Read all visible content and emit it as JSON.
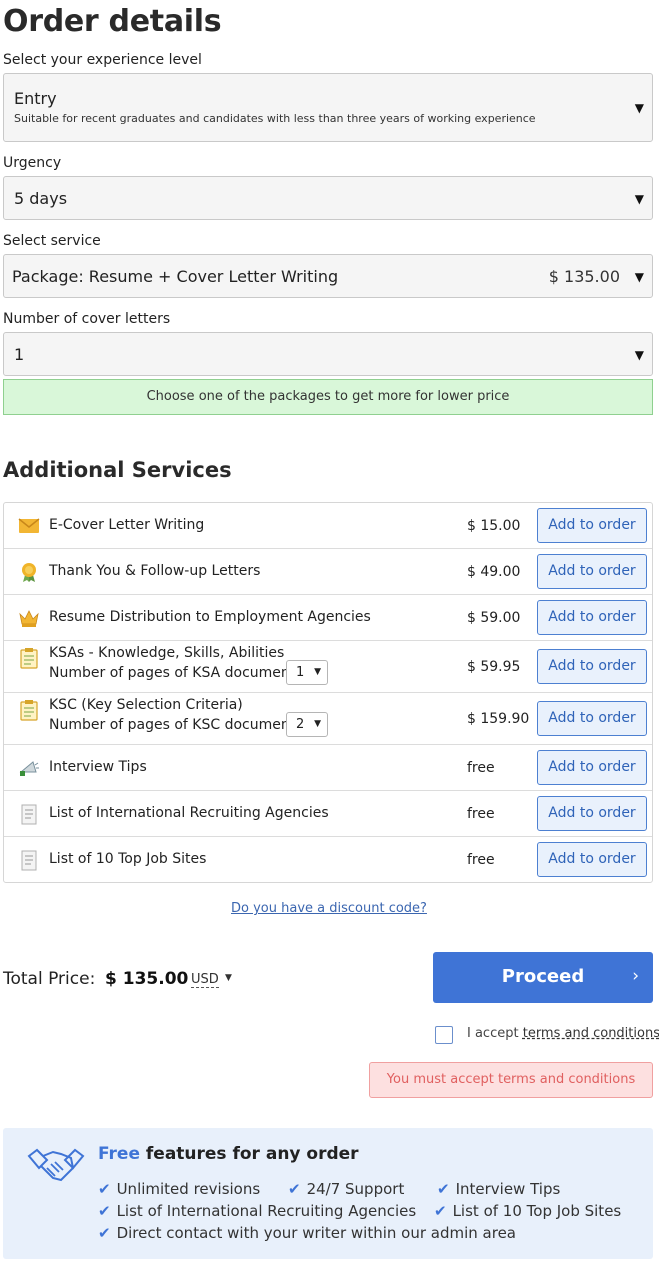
{
  "title": "Order details",
  "experience": {
    "label": "Select your experience level",
    "value": "Entry",
    "description": "Suitable for recent graduates and candidates with less than three years of working experience"
  },
  "urgency": {
    "label": "Urgency",
    "value": "5 days"
  },
  "service": {
    "label": "Select service",
    "value": "Package: Resume + Cover Letter Writing",
    "price": "$ 135.00"
  },
  "cover_letters": {
    "label": "Number of cover letters",
    "value": "1"
  },
  "promo_text": "Choose one of the packages to get more for lower price",
  "additional": {
    "title": "Additional Services",
    "button_label": "Add to order",
    "items": [
      {
        "name": "E-Cover Letter Writing",
        "price": "$ 15.00",
        "icon": "envelope-icon"
      },
      {
        "name": "Thank You & Follow-up Letters",
        "price": "$ 49.00",
        "icon": "award-icon"
      },
      {
        "name": "Resume Distribution to Employment Agencies",
        "price": "$ 59.00",
        "icon": "crown-icon"
      },
      {
        "name": "KSAs - Knowledge, Skills, Abilities",
        "sub_label": "Number of pages of KSA document:",
        "pages": "1",
        "price": "$ 59.95",
        "icon": "clipboard-icon"
      },
      {
        "name": "KSC (Key Selection Criteria)",
        "sub_label": "Number of pages of KSC document:",
        "pages": "2",
        "price": "$ 159.90",
        "icon": "clipboard-icon"
      },
      {
        "name": "Interview Tips",
        "price": "free",
        "icon": "megaphone-icon"
      },
      {
        "name": "List of International Recruiting Agencies",
        "price": "free",
        "icon": "document-icon"
      },
      {
        "name": "List of 10 Top Job Sites",
        "price": "free",
        "icon": "document-icon"
      }
    ]
  },
  "discount_link": "Do you have a discount code?",
  "total": {
    "label": "Total Price:",
    "value": "$ 135.00",
    "currency": "USD"
  },
  "proceed_label": "Proceed",
  "accept": {
    "prefix": "I accept ",
    "link": "terms and conditions"
  },
  "error_text": "You must accept terms and conditions",
  "features": {
    "free_word": "Free",
    "heading_rest": " features for any order",
    "items": [
      "Unlimited revisions",
      "24/7 Support",
      "Interview Tips",
      "List of International Recruiting Agencies",
      "List of 10 Top Job Sites",
      "Direct contact with your writer within our admin area"
    ]
  },
  "colors": {
    "accent": "#3f74d6",
    "promo_bg": "#d9f7d9",
    "error_bg": "#fde0e0",
    "error_text": "#e06060"
  }
}
